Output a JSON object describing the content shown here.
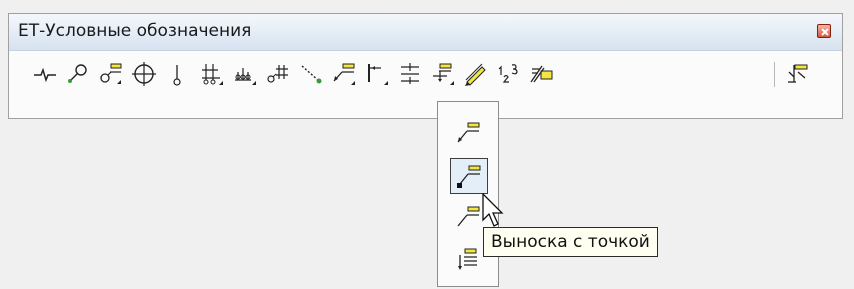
{
  "window": {
    "title": "ЕТ-Условные обозначения"
  },
  "toolbar": {
    "tools": [
      {
        "icon": "break-line-icon"
      },
      {
        "icon": "leader-circle-icon"
      },
      {
        "icon": "leader-shelf-flyout-icon"
      },
      {
        "icon": "crosshair-circle-icon"
      },
      {
        "icon": "point-mark-icon"
      },
      {
        "icon": "hatch-base-icon"
      },
      {
        "icon": "base-symbol-icon"
      },
      {
        "icon": "grid-leader-icon"
      },
      {
        "icon": "dotted-line-icon"
      },
      {
        "icon": "leader-with-shelf-icon"
      },
      {
        "icon": "vertical-dimension-icon"
      },
      {
        "icon": "tolerance-frame-icon"
      },
      {
        "icon": "level-mark-icon"
      },
      {
        "icon": "pencil-icon"
      },
      {
        "icon": "numbering-123-icon"
      },
      {
        "icon": "format-painter-icon"
      },
      {
        "icon": "roughness-icon"
      }
    ]
  },
  "flyout": {
    "items": [
      {
        "icon": "leader-arrow-icon"
      },
      {
        "icon": "leader-dot-icon"
      },
      {
        "icon": "leader-slash-icon"
      },
      {
        "icon": "leader-multi-icon"
      }
    ],
    "active_index": 1
  },
  "tooltip": {
    "text": "Выноска с точкой"
  },
  "colors": {
    "titlebar_top": "#f4f8fc",
    "titlebar_bottom": "#d6e2ef",
    "close_button": "#d25a3f",
    "tag_yellow": "#f3e640",
    "tooltip_bg": "#fffff1"
  }
}
